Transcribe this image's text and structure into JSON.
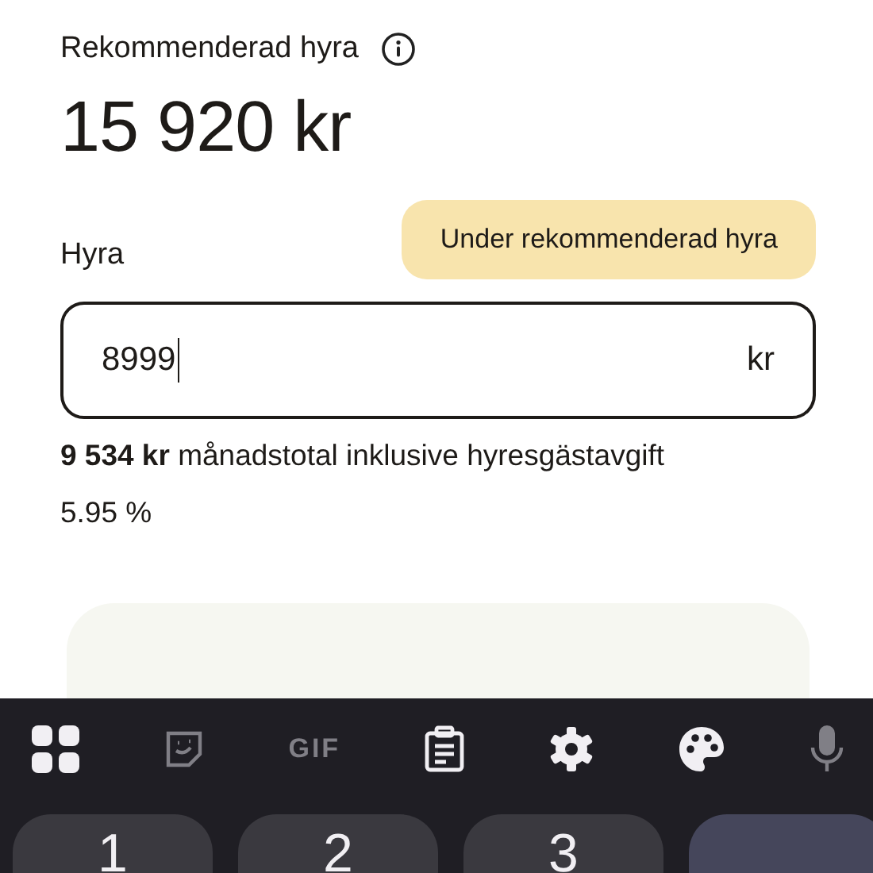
{
  "recommended": {
    "label": "Rekommenderad hyra",
    "amount": "15 920 kr"
  },
  "rent": {
    "label": "Hyra",
    "badge": "Under rekommenderad hyra",
    "value": "8999",
    "unit": "kr",
    "total": "**9 534 kr** månadstotal inklusive hyresgästavgift",
    "fee": "5.95 %"
  },
  "keyboard": {
    "toolbar": [
      {
        "kind": "grid",
        "disabled": false
      },
      {
        "kind": "sticker",
        "disabled": true
      },
      {
        "kind": "gif",
        "label": "GIF",
        "disabled": true
      },
      {
        "kind": "clipboard",
        "disabled": false
      },
      {
        "kind": "settings",
        "disabled": false
      },
      {
        "kind": "palette",
        "disabled": false
      },
      {
        "kind": "mic",
        "disabled": true
      }
    ],
    "keys": [
      {
        "label": "1",
        "kind": "digit"
      },
      {
        "label": "2",
        "kind": "digit"
      },
      {
        "label": "3",
        "kind": "digit"
      },
      {
        "kind": "action"
      }
    ]
  }
}
